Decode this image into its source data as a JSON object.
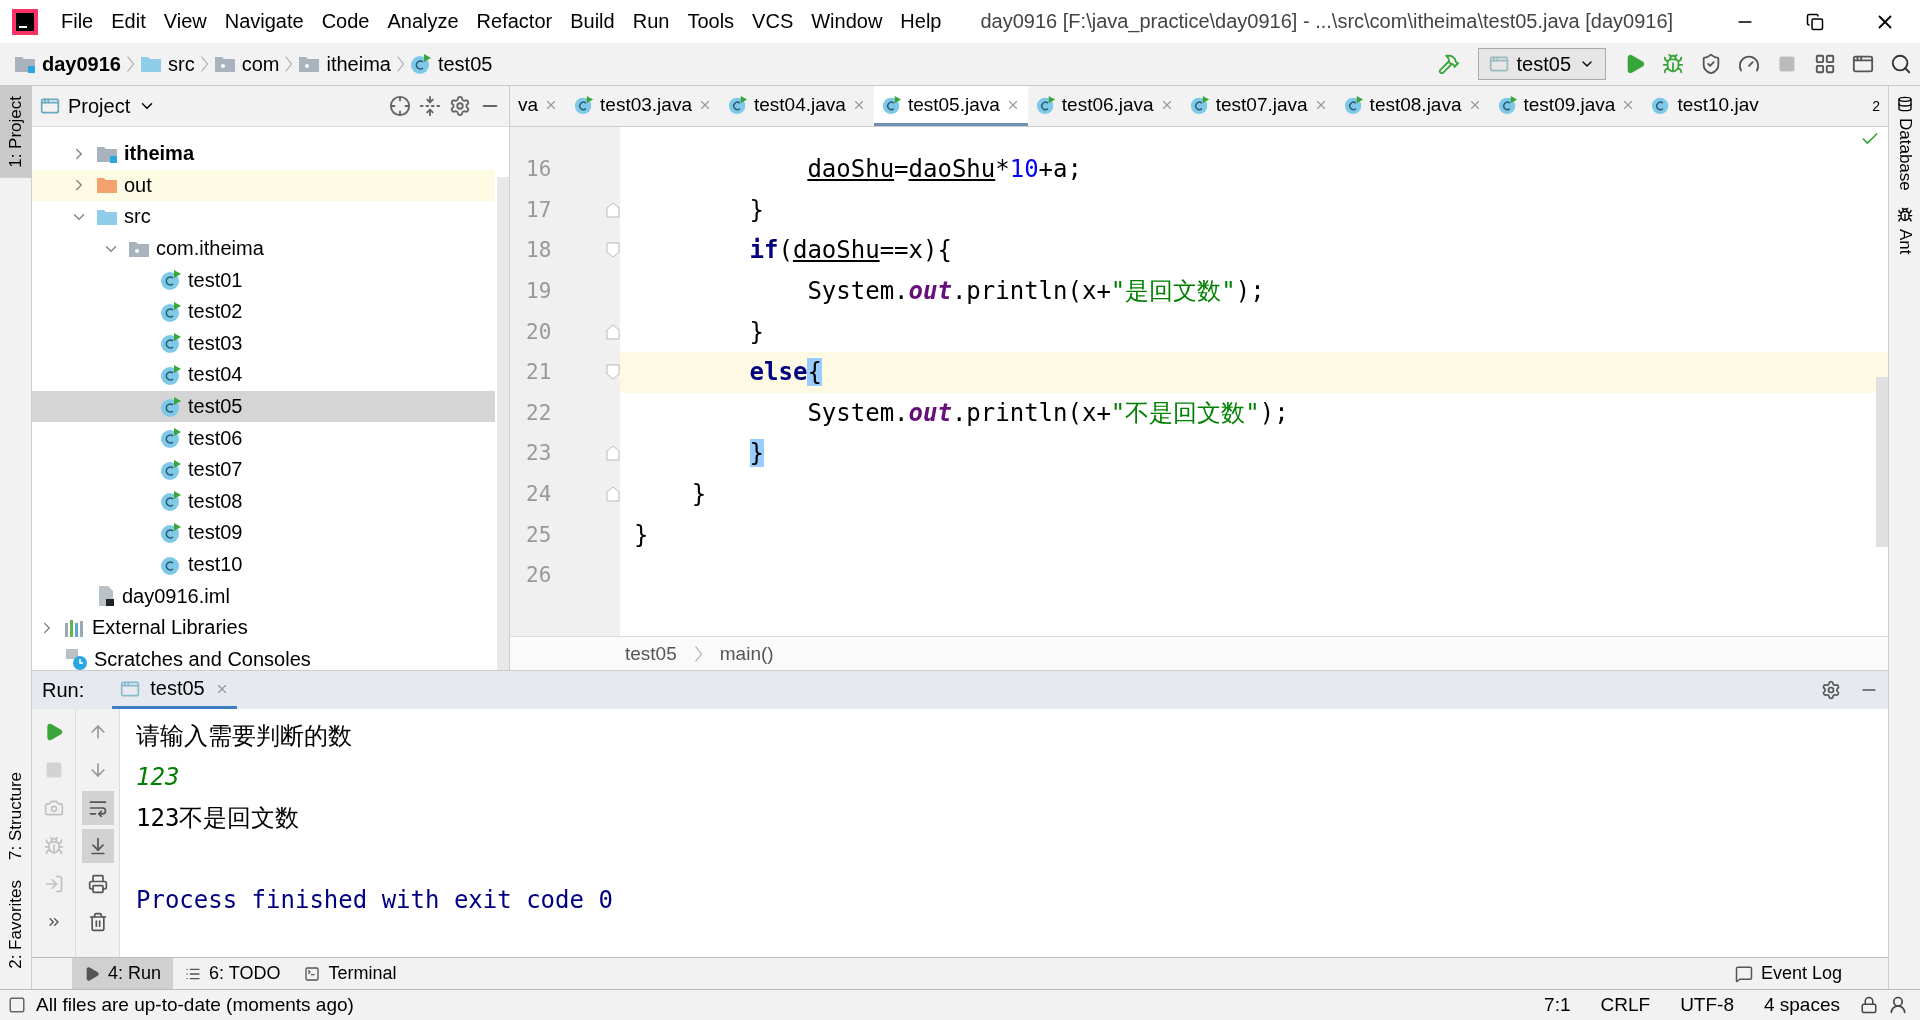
{
  "title_bar": {
    "menu": [
      "File",
      "Edit",
      "View",
      "Navigate",
      "Code",
      "Analyze",
      "Refactor",
      "Build",
      "Run",
      "Tools",
      "VCS",
      "Window",
      "Help"
    ],
    "title": "day0916 [F:\\java_practice\\day0916] - ...\\src\\com\\itheima\\test05.java [day0916]"
  },
  "nav_bar": {
    "breadcrumbs": [
      {
        "label": "day0916",
        "kind": "module"
      },
      {
        "label": "src",
        "kind": "source-folder"
      },
      {
        "label": "com",
        "kind": "package"
      },
      {
        "label": "itheima",
        "kind": "package"
      },
      {
        "label": "test05",
        "kind": "runnable-class"
      }
    ],
    "run_config": "test05"
  },
  "left_strip": [
    {
      "label": "1: Project",
      "kind": "top",
      "selected": true
    },
    {
      "label": "7: Structure",
      "kind": "bottom",
      "selected": false
    },
    {
      "label": "2: Favorites",
      "kind": "bottom",
      "selected": false
    }
  ],
  "right_strip": [
    "Database",
    "Ant"
  ],
  "project_panel": {
    "title": "Project",
    "module_items": [
      {
        "label": "itheima",
        "kind": "module",
        "expanded": false,
        "selected": false
      },
      {
        "label": "out",
        "kind": "excluded-folder",
        "expanded": false,
        "selected": false
      },
      {
        "label": "src",
        "kind": "source-folder",
        "expanded": true,
        "selected": false,
        "children": [
          {
            "label": "com.itheima",
            "kind": "package",
            "expanded": true,
            "selected": false,
            "children": [
              {
                "label": "test01",
                "kind": "runnable-class",
                "selected": false
              },
              {
                "label": "test02",
                "kind": "runnable-class",
                "selected": false
              },
              {
                "label": "test03",
                "kind": "runnable-class",
                "selected": false
              },
              {
                "label": "test04",
                "kind": "runnable-class",
                "selected": false
              },
              {
                "label": "test05",
                "kind": "runnable-class",
                "selected": true
              },
              {
                "label": "test06",
                "kind": "runnable-class",
                "selected": false
              },
              {
                "label": "test07",
                "kind": "runnable-class",
                "selected": false
              },
              {
                "label": "test08",
                "kind": "runnable-class",
                "selected": false
              },
              {
                "label": "test09",
                "kind": "runnable-class",
                "selected": false
              },
              {
                "label": "test10",
                "kind": "class",
                "selected": false
              }
            ]
          }
        ]
      },
      {
        "label": "day0916.iml",
        "kind": "iml",
        "selected": false
      }
    ],
    "items": [
      {
        "label": "External Libraries",
        "kind": "libraries",
        "expanded": false,
        "selected": false
      },
      {
        "label": "Scratches and Consoles",
        "kind": "scratches",
        "selected": false
      }
    ]
  },
  "editor": {
    "tabs": [
      {
        "label": "va",
        "kind": "plain",
        "selected": false
      },
      {
        "label": "test03.java",
        "kind": "runnable-class",
        "selected": false
      },
      {
        "label": "test04.java",
        "kind": "runnable-class",
        "selected": false
      },
      {
        "label": "test05.java",
        "kind": "runnable-class",
        "selected": true
      },
      {
        "label": "test06.java",
        "kind": "runnable-class",
        "selected": false
      },
      {
        "label": "test07.java",
        "kind": "runnable-class",
        "selected": false
      },
      {
        "label": "test08.java",
        "kind": "runnable-class",
        "selected": false
      },
      {
        "label": "test09.java",
        "kind": "runnable-class",
        "selected": false
      },
      {
        "label": "test10.jav",
        "kind": "class",
        "selected": false
      }
    ],
    "hidden_tabs": "2",
    "lines": [
      {
        "children": [
          {
            "children": [
              {
                "children": [
                  {
                    "number": "16",
                    "current": false,
                    "tokens": [
                      {
                        "kind": "var",
                        "text": "daoShu"
                      },
                      {
                        "kind": "plain",
                        "text": "="
                      },
                      {
                        "kind": "var",
                        "text": "daoShu"
                      },
                      {
                        "kind": "plain",
                        "text": "*"
                      },
                      {
                        "kind": "number",
                        "text": "10"
                      },
                      {
                        "kind": "plain",
                        "text": "+a;"
                      }
                    ]
                  }
                ]
              },
              {
                "number": "17",
                "current": false,
                "fold_end": true,
                "tokens": [
                  {
                    "kind": "plain",
                    "text": "}"
                  }
                ]
              },
              {
                "number": "18",
                "current": false,
                "fold_start": true,
                "tokens": [
                  {
                    "kind": "keyword",
                    "text": "if"
                  },
                  {
                    "kind": "plain",
                    "text": "("
                  },
                  {
                    "kind": "var",
                    "text": "daoShu"
                  },
                  {
                    "kind": "plain",
                    "text": "==x){"
                  }
                ],
                "children": [
                  {
                    "number": "19",
                    "current": false,
                    "tokens": [
                      {
                        "kind": "plain",
                        "text": "System."
                      },
                      {
                        "kind": "field",
                        "text": "out"
                      },
                      {
                        "kind": "plain",
                        "text": ".println(x+"
                      },
                      {
                        "kind": "string",
                        "text": "\"是回文数\""
                      },
                      {
                        "kind": "plain",
                        "text": ");"
                      }
                    ]
                  }
                ]
              },
              {
                "number": "20",
                "current": false,
                "fold_end": true,
                "tokens": [
                  {
                    "kind": "plain",
                    "text": "}"
                  }
                ]
              },
              {
                "number": "21",
                "current": true,
                "fold_start": true,
                "tokens": [
                  {
                    "kind": "keyword",
                    "text": "else"
                  },
                  {
                    "kind": "plain",
                    "text": "{",
                    "matched": true
                  }
                ],
                "children": [
                  {
                    "number": "22",
                    "current": false,
                    "tokens": [
                      {
                        "kind": "plain",
                        "text": "System."
                      },
                      {
                        "kind": "field",
                        "text": "out"
                      },
                      {
                        "kind": "plain",
                        "text": ".println(x+"
                      },
                      {
                        "kind": "string",
                        "text": "\"不是回文数\""
                      },
                      {
                        "kind": "plain",
                        "text": ");"
                      }
                    ]
                  }
                ]
              },
              {
                "number": "23",
                "current": false,
                "fold_end": true,
                "tokens": [
                  {
                    "kind": "plain",
                    "text": "}",
                    "matched": true
                  }
                ]
              }
            ]
          },
          {
            "number": "24",
            "current": false,
            "fold_end": true,
            "tokens": [
              {
                "kind": "plain",
                "text": "}"
              }
            ]
          }
        ]
      },
      {
        "number": "25",
        "current": false,
        "tokens": [
          {
            "kind": "plain",
            "text": "}"
          }
        ]
      },
      {
        "number": "26",
        "current": false
      }
    ],
    "breadcrumbs": [
      "test05",
      "main()"
    ]
  },
  "run_panel": {
    "label": "Run:",
    "tab": "test05",
    "tools_left": [
      {
        "kind": "rerun",
        "disabled": false
      },
      {
        "kind": "stop",
        "disabled": true
      },
      {
        "kind": "camera",
        "disabled": true
      },
      {
        "kind": "debug",
        "disabled": true
      },
      {
        "kind": "export",
        "disabled": true
      },
      {
        "kind": "more",
        "disabled": false
      }
    ],
    "tools_right": [
      {
        "kind": "up",
        "on": false
      },
      {
        "kind": "down",
        "on": false
      },
      {
        "kind": "wrap",
        "on": true
      },
      {
        "kind": "scroll-end",
        "on": true
      },
      {
        "kind": "print",
        "on": false
      },
      {
        "kind": "trash",
        "on": false
      }
    ],
    "console": [
      {
        "kind": "output",
        "text": "请输入需要判断的数"
      },
      {
        "kind": "input",
        "text": "123"
      },
      {
        "kind": "output",
        "text": "123不是回文数"
      },
      {
        "kind": "blank"
      },
      {
        "kind": "system",
        "text": "Process finished with exit code 0"
      }
    ]
  },
  "tool_tabs": [
    {
      "label": "4: Run",
      "kind": "run",
      "selected": true
    },
    {
      "label": "6: TODO",
      "kind": "todo",
      "selected": false
    },
    {
      "label": "Terminal",
      "kind": "terminal",
      "selected": false
    }
  ],
  "event_log": "Event Log",
  "status_bar": {
    "message": "All files are up-to-date (moments ago)",
    "items": [
      "7:1",
      "CRLF",
      "UTF-8",
      "4 spaces"
    ]
  }
}
